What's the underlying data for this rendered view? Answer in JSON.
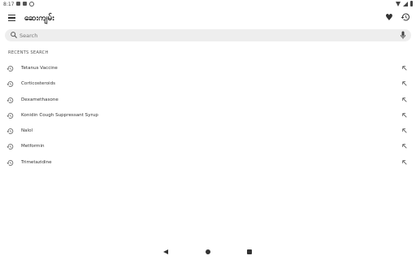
{
  "status": {
    "time": "8:17"
  },
  "app": {
    "title": "ဆေးကျမ်း"
  },
  "search": {
    "placeholder": "Search"
  },
  "recent": {
    "label": "RECENTS SEARCH",
    "items": [
      {
        "label": "Tetanus Vaccine"
      },
      {
        "label": "Corticosteroids"
      },
      {
        "label": "Dexamethasone"
      },
      {
        "label": "Konidin Cough Suppressant Syrup"
      },
      {
        "label": "Nalol"
      },
      {
        "label": "Metformin"
      },
      {
        "label": "Trimetazidine"
      }
    ]
  },
  "icons": {
    "menu": "menu-icon",
    "favorite": "heart-icon",
    "history": "history-icon",
    "search": "search-icon",
    "mic": "mic-icon",
    "recent_item": "history-icon",
    "fill_query": "arrow-up-left-icon"
  },
  "colors": {
    "background": "#ffffff",
    "search_bg": "#eeeeee",
    "text": "#333333"
  }
}
